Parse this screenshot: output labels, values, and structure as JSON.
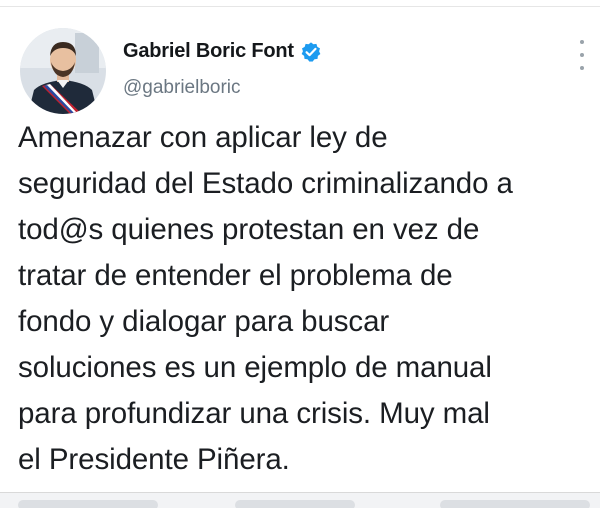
{
  "tweet": {
    "author_name": "Gabriel Boric Font",
    "handle": "@gabrielboric",
    "verified_icon": "verified-badge-icon",
    "more_icon": "more-vertical-icon",
    "text_lines": [
      "Amenazar con aplicar ley de",
      "seguridad del Estado criminalizando a",
      "tod@s quienes protestan en vez de",
      "tratar de entender el problema de",
      "fondo y dialogar para buscar",
      "soluciones es un ejemplo de manual",
      "para profundizar una crisis. Muy mal",
      "el Presidente Piñera."
    ]
  },
  "colors": {
    "verified_blue": "#1d9bf0",
    "handle_gray": "#6b7782",
    "text": "#1b1e22"
  }
}
